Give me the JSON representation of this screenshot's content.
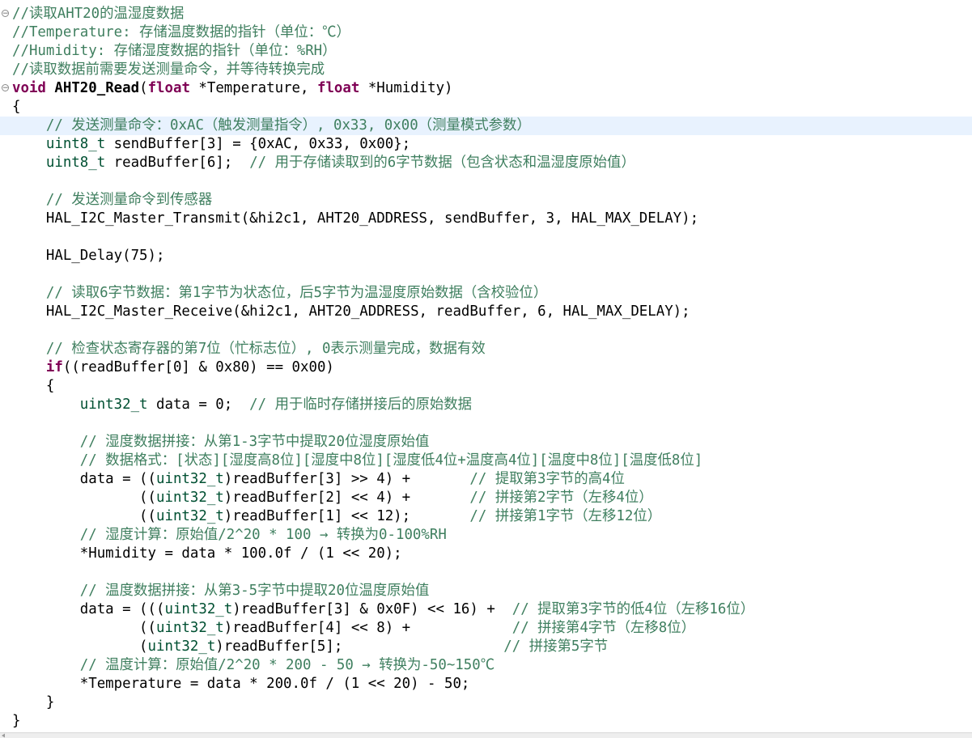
{
  "editor": {
    "lines": [
      {
        "fold": "⊖",
        "parts": [
          {
            "s": "c",
            "t": "//读取AHT20的温湿度数据"
          }
        ]
      },
      {
        "parts": [
          {
            "s": "c",
            "t": "//Temperature: 存储温度数据的指针（单位：℃）"
          }
        ]
      },
      {
        "parts": [
          {
            "s": "c",
            "t": "//Humidity: 存储湿度数据的指针（单位：%RH）"
          }
        ]
      },
      {
        "parts": [
          {
            "s": "c",
            "t": "//读取数据前需要发送测量命令，并等待转换完成"
          }
        ]
      },
      {
        "fold": "⊖",
        "parts": [
          {
            "s": "k",
            "t": "void"
          },
          {
            "s": "",
            "t": " "
          },
          {
            "s": "fb",
            "t": "AHT20_Read"
          },
          {
            "s": "",
            "t": "("
          },
          {
            "s": "k",
            "t": "float"
          },
          {
            "s": "",
            "t": " *Temperature, "
          },
          {
            "s": "k",
            "t": "float"
          },
          {
            "s": "",
            "t": " *Humidity)"
          }
        ]
      },
      {
        "parts": [
          {
            "s": "",
            "t": "{"
          }
        ]
      },
      {
        "current": true,
        "parts": [
          {
            "s": "",
            "t": "    "
          },
          {
            "s": "c",
            "t": "// 发送测量命令：0xAC（触发测量指令）, 0x33, 0x00（测量模式参数）"
          }
        ]
      },
      {
        "parts": [
          {
            "s": "",
            "t": "    "
          },
          {
            "s": "t",
            "t": "uint8_t"
          },
          {
            "s": "",
            "t": " sendBuffer[3] = {0xAC, 0x33, 0x00};"
          }
        ]
      },
      {
        "parts": [
          {
            "s": "",
            "t": "    "
          },
          {
            "s": "t",
            "t": "uint8_t"
          },
          {
            "s": "",
            "t": " readBuffer[6];  "
          },
          {
            "s": "c",
            "t": "// 用于存储读取到的6字节数据（包含状态和温湿度原始值）"
          }
        ]
      },
      {
        "parts": [
          {
            "s": "",
            "t": ""
          }
        ]
      },
      {
        "parts": [
          {
            "s": "",
            "t": "    "
          },
          {
            "s": "c",
            "t": "// 发送测量命令到传感器"
          }
        ]
      },
      {
        "parts": [
          {
            "s": "",
            "t": "    HAL_I2C_Master_Transmit(&hi2c1, AHT20_ADDRESS, sendBuffer, 3, HAL_MAX_DELAY);"
          }
        ]
      },
      {
        "parts": [
          {
            "s": "",
            "t": ""
          }
        ]
      },
      {
        "parts": [
          {
            "s": "",
            "t": "    HAL_Delay(75);"
          }
        ]
      },
      {
        "parts": [
          {
            "s": "",
            "t": ""
          }
        ]
      },
      {
        "parts": [
          {
            "s": "",
            "t": "    "
          },
          {
            "s": "c",
            "t": "// 读取6字节数据：第1字节为状态位，后5字节为温湿度原始数据（含校验位）"
          }
        ]
      },
      {
        "parts": [
          {
            "s": "",
            "t": "    HAL_I2C_Master_Receive(&hi2c1, AHT20_ADDRESS, readBuffer, 6, HAL_MAX_DELAY);"
          }
        ]
      },
      {
        "parts": [
          {
            "s": "",
            "t": ""
          }
        ]
      },
      {
        "parts": [
          {
            "s": "",
            "t": "    "
          },
          {
            "s": "c",
            "t": "// 检查状态寄存器的第7位（忙标志位）, 0表示测量完成，数据有效"
          }
        ]
      },
      {
        "parts": [
          {
            "s": "",
            "t": "    "
          },
          {
            "s": "k",
            "t": "if"
          },
          {
            "s": "",
            "t": "((readBuffer[0] & 0x80) == 0x00)"
          }
        ]
      },
      {
        "parts": [
          {
            "s": "",
            "t": "    {"
          }
        ]
      },
      {
        "parts": [
          {
            "s": "",
            "t": "        "
          },
          {
            "s": "t",
            "t": "uint32_t"
          },
          {
            "s": "",
            "t": " data = 0;  "
          },
          {
            "s": "c",
            "t": "// 用于临时存储拼接后的原始数据"
          }
        ]
      },
      {
        "parts": [
          {
            "s": "",
            "t": ""
          }
        ]
      },
      {
        "parts": [
          {
            "s": "",
            "t": "        "
          },
          {
            "s": "c",
            "t": "// 湿度数据拼接：从第1-3字节中提取20位湿度原始值"
          }
        ]
      },
      {
        "parts": [
          {
            "s": "",
            "t": "        "
          },
          {
            "s": "c",
            "t": "// 数据格式：[状态][湿度高8位][湿度中8位][湿度低4位+温度高4位][温度中8位][温度低8位]"
          }
        ]
      },
      {
        "parts": [
          {
            "s": "",
            "t": "        data = (("
          },
          {
            "s": "t",
            "t": "uint32_t"
          },
          {
            "s": "",
            "t": ")readBuffer[3] >> 4) +       "
          },
          {
            "s": "c",
            "t": "// 提取第3字节的高4位"
          }
        ]
      },
      {
        "parts": [
          {
            "s": "",
            "t": "               (("
          },
          {
            "s": "t",
            "t": "uint32_t"
          },
          {
            "s": "",
            "t": ")readBuffer[2] << 4) +       "
          },
          {
            "s": "c",
            "t": "// 拼接第2字节（左移4位）"
          }
        ]
      },
      {
        "parts": [
          {
            "s": "",
            "t": "               (("
          },
          {
            "s": "t",
            "t": "uint32_t"
          },
          {
            "s": "",
            "t": ")readBuffer[1] << 12);       "
          },
          {
            "s": "c",
            "t": "// 拼接第1字节（左移12位）"
          }
        ]
      },
      {
        "parts": [
          {
            "s": "",
            "t": "        "
          },
          {
            "s": "c",
            "t": "// 湿度计算：原始值/2^20 * 100 → 转换为0-100%RH"
          }
        ]
      },
      {
        "parts": [
          {
            "s": "",
            "t": "        *Humidity = data * 100.0f / (1 << 20);"
          }
        ]
      },
      {
        "parts": [
          {
            "s": "",
            "t": ""
          }
        ]
      },
      {
        "parts": [
          {
            "s": "",
            "t": "        "
          },
          {
            "s": "c",
            "t": "// 温度数据拼接：从第3-5字节中提取20位温度原始值"
          }
        ]
      },
      {
        "parts": [
          {
            "s": "",
            "t": "        data = ((("
          },
          {
            "s": "t",
            "t": "uint32_t"
          },
          {
            "s": "",
            "t": ")readBuffer[3] & 0x0F) << 16) +  "
          },
          {
            "s": "c",
            "t": "// 提取第3字节的低4位（左移16位）"
          }
        ]
      },
      {
        "parts": [
          {
            "s": "",
            "t": "               (("
          },
          {
            "s": "t",
            "t": "uint32_t"
          },
          {
            "s": "",
            "t": ")readBuffer[4] << 8) +            "
          },
          {
            "s": "c",
            "t": "// 拼接第4字节（左移8位）"
          }
        ]
      },
      {
        "parts": [
          {
            "s": "",
            "t": "               ("
          },
          {
            "s": "t",
            "t": "uint32_t"
          },
          {
            "s": "",
            "t": ")readBuffer[5];                   "
          },
          {
            "s": "c",
            "t": "// 拼接第5字节"
          }
        ]
      },
      {
        "parts": [
          {
            "s": "",
            "t": "        "
          },
          {
            "s": "c",
            "t": "// 温度计算：原始值/2^20 * 200 - 50 → 转换为-50~150℃"
          }
        ]
      },
      {
        "parts": [
          {
            "s": "",
            "t": "        *Temperature = data * 200.0f / (1 << 20) - 50;"
          }
        ]
      },
      {
        "parts": [
          {
            "s": "",
            "t": "    }"
          }
        ]
      },
      {
        "parts": [
          {
            "s": "",
            "t": "}"
          }
        ]
      }
    ]
  }
}
